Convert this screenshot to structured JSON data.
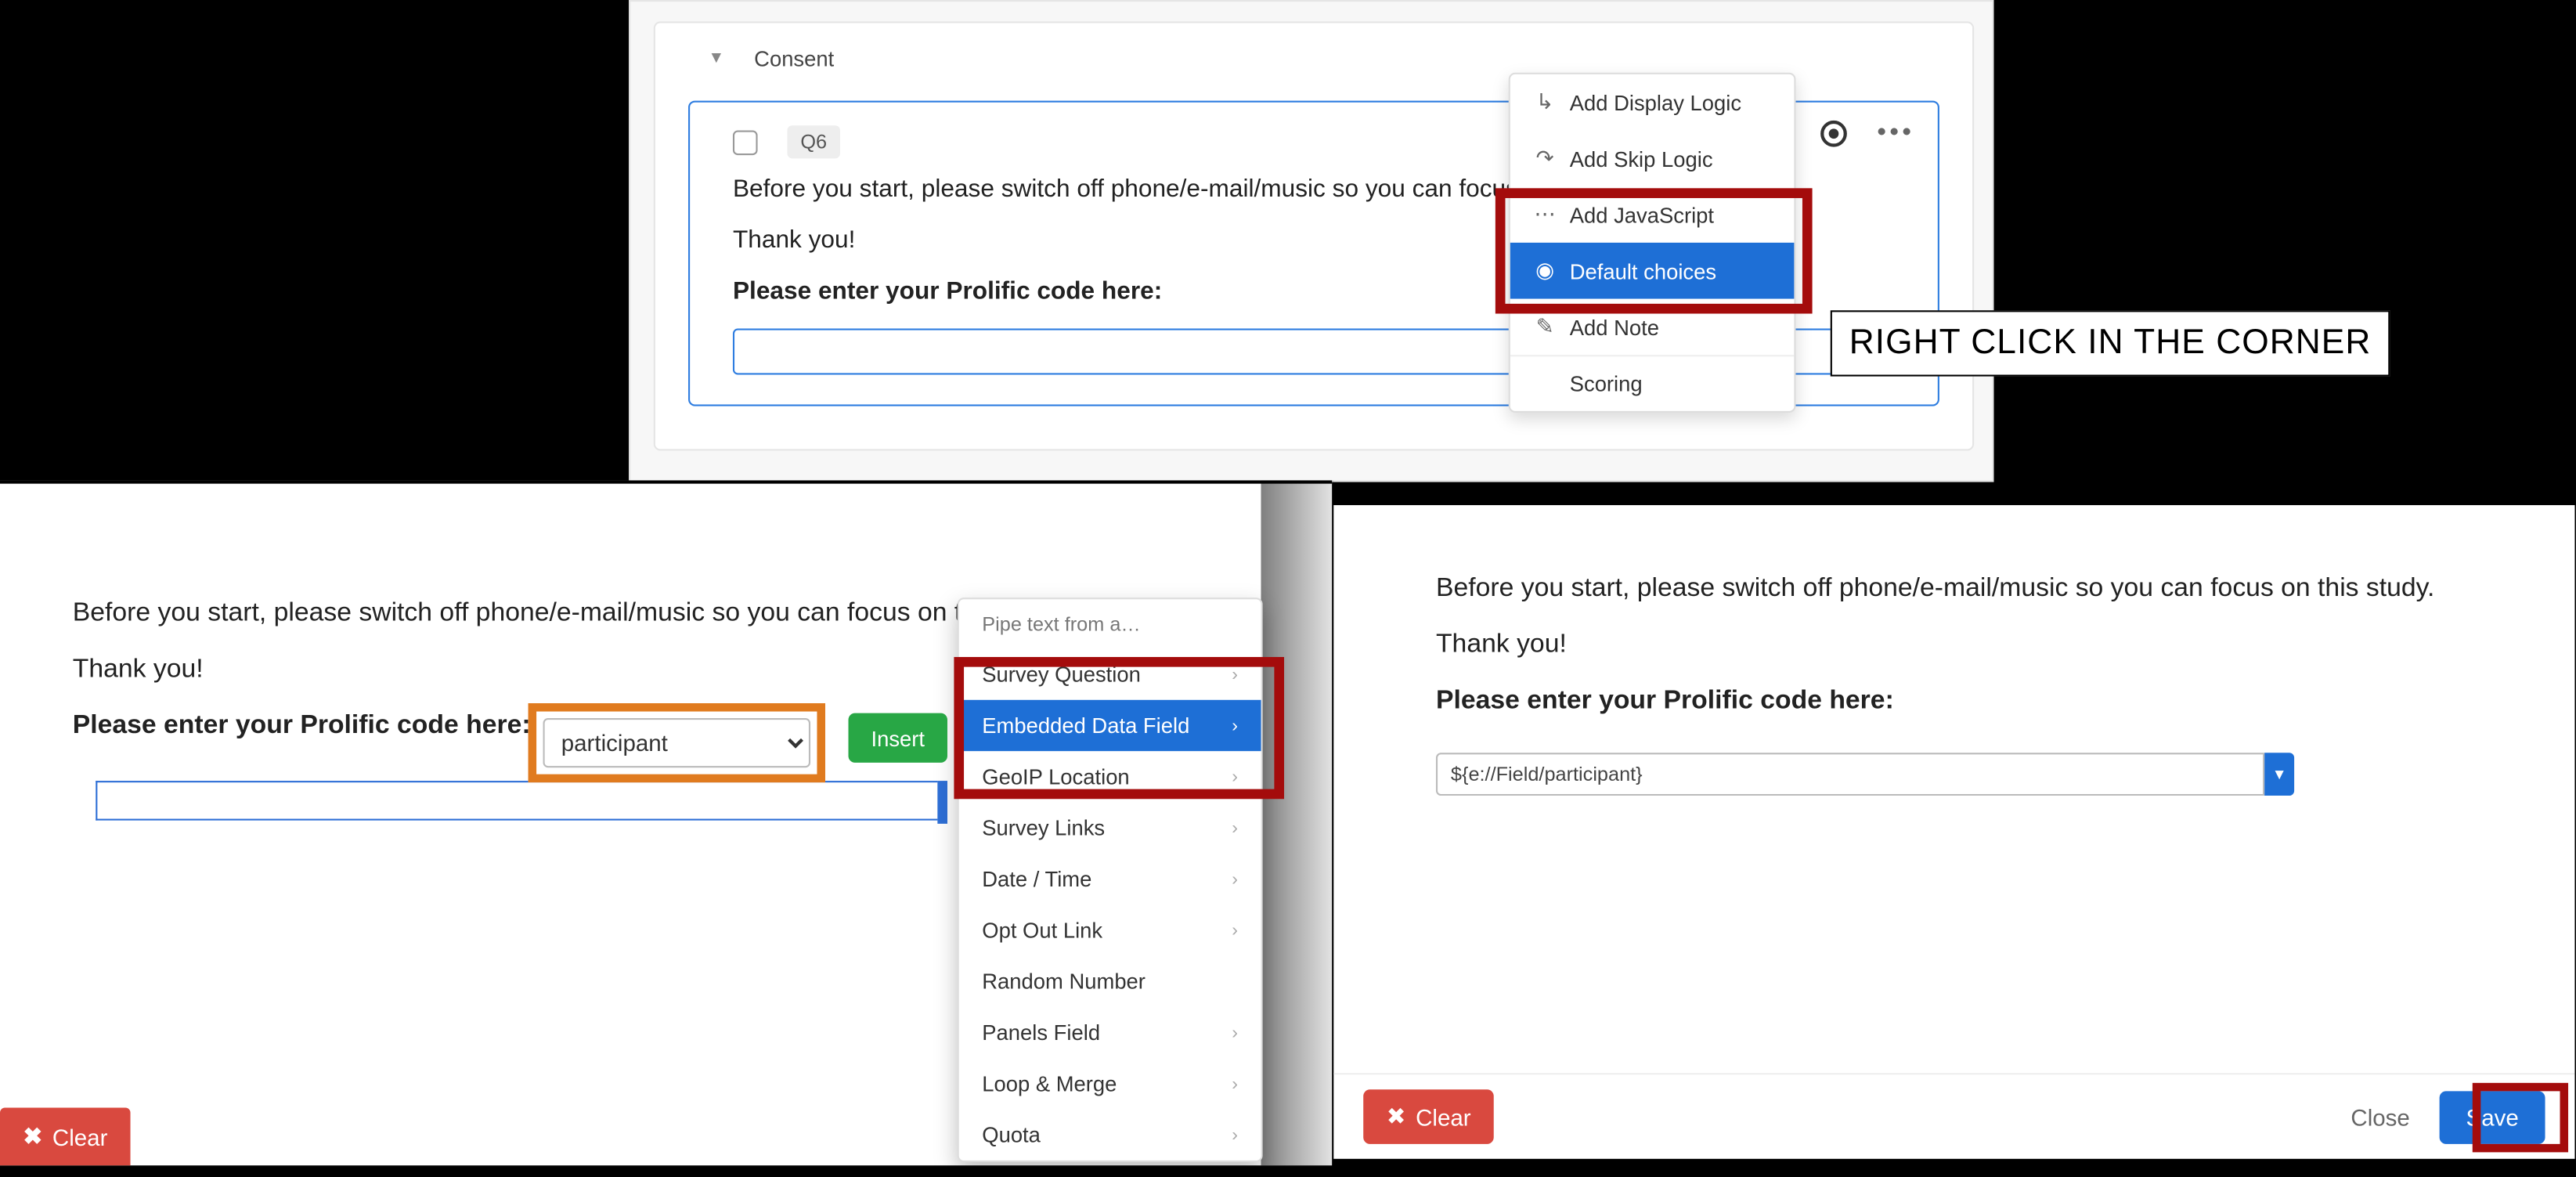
{
  "annotation": "RIGHT CLICK IN THE CORNER",
  "panel1": {
    "block_title": "Consent",
    "question_id": "Q6",
    "text_line1": "Before you start, please switch off phone/e-mail/music so you can focus on this study.",
    "text_line2": "Thank you!",
    "label": "Please enter your Prolific code here:",
    "input_value": "",
    "context_menu": {
      "items": [
        "Add Display Logic",
        "Add Skip Logic",
        "Add JavaScript",
        "Default choices",
        "Add Note",
        "Scoring"
      ],
      "selected_index": 3
    }
  },
  "panel2": {
    "text_line1": "Before you start, please switch off phone/e-mail/music so you can focus on this study.",
    "text_line2": "Thank you!",
    "label": "Please enter your Prolific code here:",
    "participant_value": "participant",
    "insert_label": "Insert",
    "clear_label": "Clear",
    "pipe_menu": {
      "header": "Pipe text from a…",
      "items": [
        "Survey Question",
        "Embedded Data Field",
        "GeoIP Location",
        "Survey Links",
        "Date / Time",
        "Opt Out Link",
        "Random Number",
        "Panels Field",
        "Loop & Merge",
        "Quota"
      ],
      "selected_index": 1
    }
  },
  "panel3": {
    "text_line1": "Before you start, please switch off phone/e-mail/music so you can focus on this study.",
    "text_line2": "Thank you!",
    "label": "Please enter your Prolific code here:",
    "field_value": "${e://Field/participant}",
    "clear_label": "Clear",
    "close_label": "Close",
    "save_label": "Save"
  }
}
